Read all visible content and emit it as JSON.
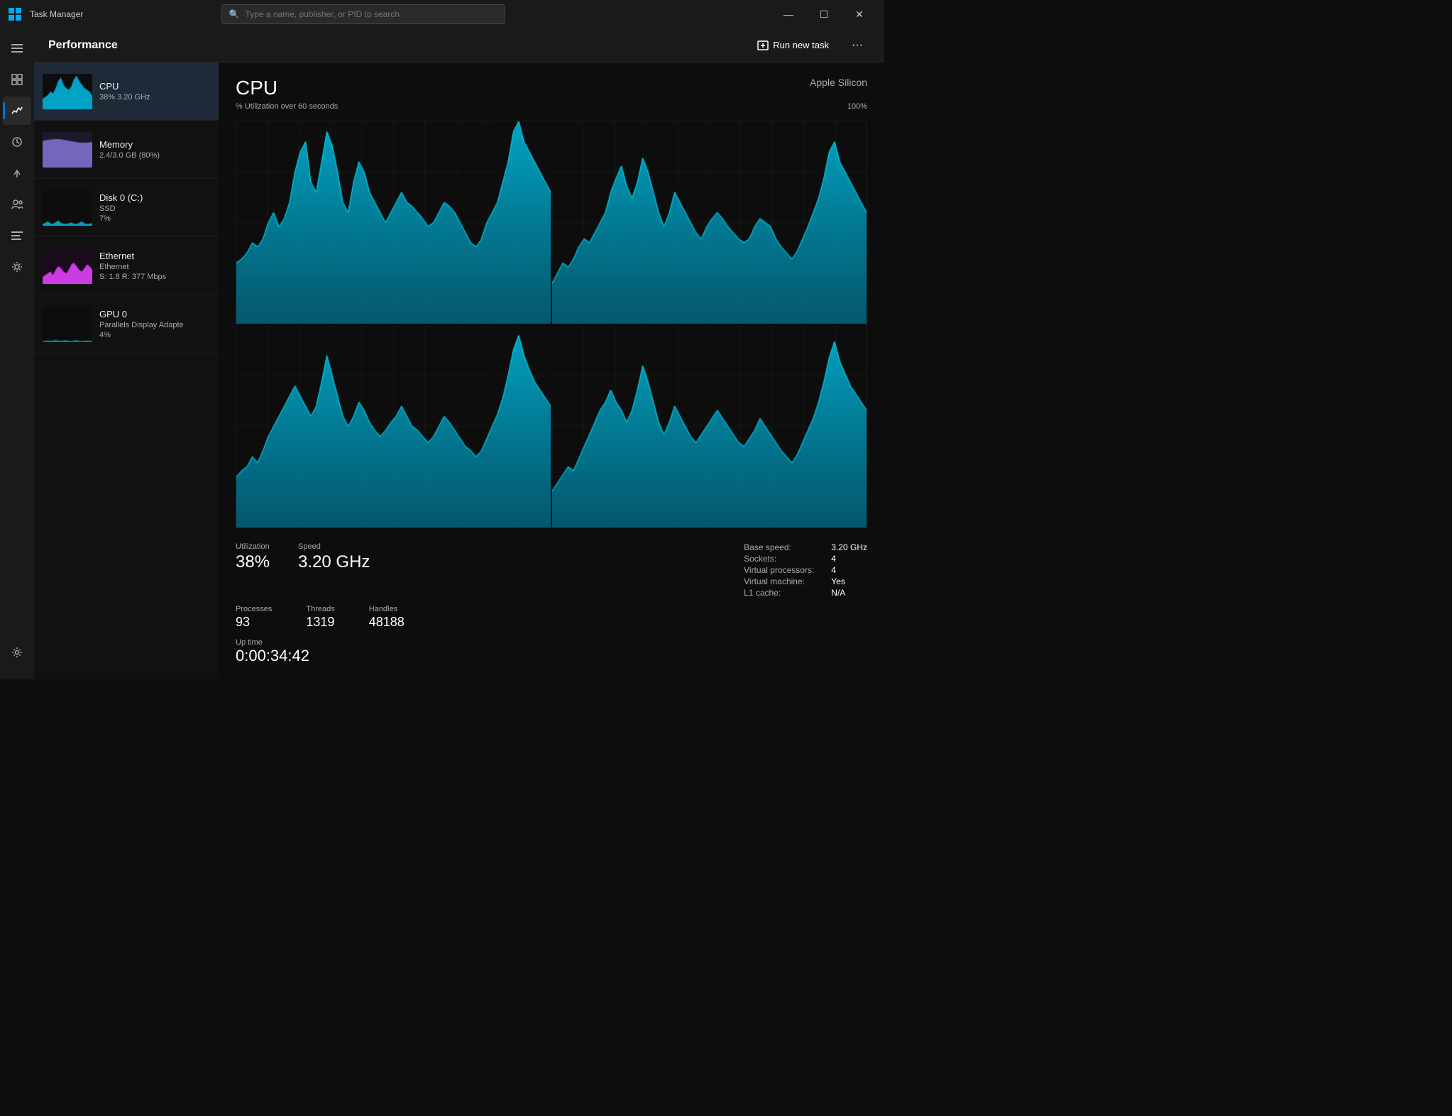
{
  "titlebar": {
    "title": "Task Manager",
    "search_placeholder": "Type a name, publisher, or PID to search",
    "min_btn": "—",
    "max_btn": "☐",
    "close_btn": "✕"
  },
  "header": {
    "title": "Performance",
    "run_task_label": "Run new task",
    "more_label": "···"
  },
  "sidebar": {
    "icons": [
      {
        "name": "hamburger-icon",
        "symbol": "≡"
      },
      {
        "name": "summary-icon",
        "symbol": "⊞"
      },
      {
        "name": "performance-icon",
        "symbol": "📈"
      },
      {
        "name": "history-icon",
        "symbol": "🕒"
      },
      {
        "name": "startup-icon",
        "symbol": "⚡"
      },
      {
        "name": "users-icon",
        "symbol": "👥"
      },
      {
        "name": "details-icon",
        "symbol": "☰"
      },
      {
        "name": "services-icon",
        "symbol": "⚙"
      }
    ],
    "bottom_icon": {
      "name": "settings-icon",
      "symbol": "⚙"
    }
  },
  "resources": [
    {
      "name": "CPU",
      "sub": "38%  3.20 GHz",
      "color": "#00b4d8",
      "active": true
    },
    {
      "name": "Memory",
      "sub": "2.4/3.0 GB (80%)",
      "color": "#7c6fcd",
      "active": false
    },
    {
      "name": "Disk 0 (C:)",
      "sub": "SSD",
      "sub2": "7%",
      "color": "#00b4d8",
      "active": false
    },
    {
      "name": "Ethernet",
      "sub": "Ethernet",
      "sub2": "S: 1.8  R: 377 Mbps",
      "color": "#e040fb",
      "active": false
    },
    {
      "name": "GPU 0",
      "sub": "Parallels Display Adapte",
      "sub2": "4%",
      "color": "#00b4d8",
      "active": false
    }
  ],
  "detail": {
    "title": "CPU",
    "subtitle": "Apple Silicon",
    "graph_label": "% Utilization over 60 seconds",
    "scale_max": "100%"
  },
  "stats": {
    "utilization_label": "Utilization",
    "utilization_value": "38%",
    "speed_label": "Speed",
    "speed_value": "3.20 GHz",
    "processes_label": "Processes",
    "processes_value": "93",
    "threads_label": "Threads",
    "threads_value": "1319",
    "handles_label": "Handles",
    "handles_value": "48188",
    "uptime_label": "Up time",
    "uptime_value": "0:00:34:42"
  },
  "specs": {
    "base_speed_label": "Base speed:",
    "base_speed_value": "3.20 GHz",
    "sockets_label": "Sockets:",
    "sockets_value": "4",
    "vproc_label": "Virtual processors:",
    "vproc_value": "4",
    "vm_label": "Virtual machine:",
    "vm_value": "Yes",
    "l1_label": "L1 cache:",
    "l1_value": "N/A"
  }
}
